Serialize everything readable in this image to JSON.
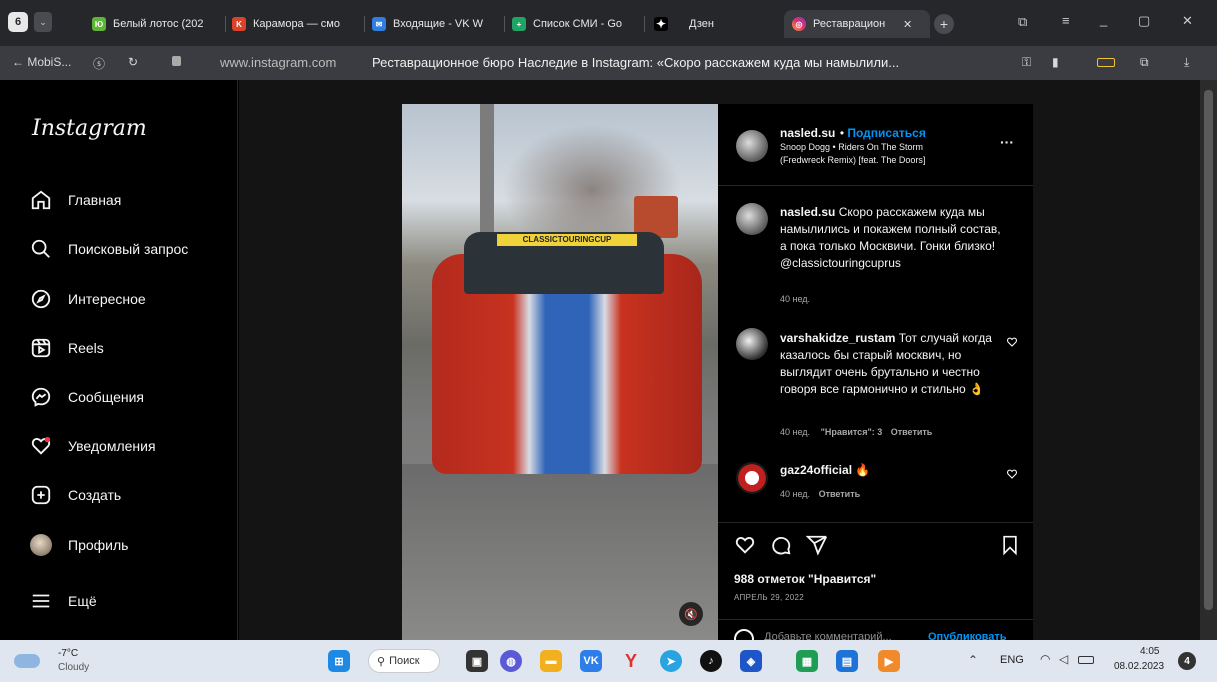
{
  "browser": {
    "tab_count": "6",
    "tabs": [
      {
        "label": "Белый лотос (202",
        "color": "#5fb336",
        "glyph": "Ю"
      },
      {
        "label": "Карамора — смо",
        "color": "#d8432a",
        "glyph": "K"
      },
      {
        "label": "Входящие - VK W",
        "color": "#2f7de1",
        "glyph": "✉"
      },
      {
        "label": "Список СМИ - Go",
        "color": "#1fa463",
        "glyph": "+"
      },
      {
        "label": "Дзен",
        "color": "#000000",
        "glyph": "✦"
      },
      {
        "label": "Реставрацион",
        "color": "#e1306c",
        "glyph": "◎"
      }
    ],
    "back_label": "← MobiS...",
    "url": "www.instagram.com",
    "page_title": "Реставрационное бюро Наследие в Instagram: «Скоро расскажем куда мы намылили..."
  },
  "sidebar": {
    "logo": "Instagram",
    "items": [
      {
        "label": "Главная",
        "icon": "home-icon"
      },
      {
        "label": "Поисковый запрос",
        "icon": "search-icon"
      },
      {
        "label": "Интересное",
        "icon": "explore-icon"
      },
      {
        "label": "Reels",
        "icon": "reels-icon"
      },
      {
        "label": "Сообщения",
        "icon": "messenger-icon"
      },
      {
        "label": "Уведомления",
        "icon": "heart-icon"
      },
      {
        "label": "Создать",
        "icon": "create-icon"
      },
      {
        "label": "Профиль",
        "icon": "profile-avatar"
      },
      {
        "label": "Ещё",
        "icon": "menu-icon"
      }
    ]
  },
  "post": {
    "photo_banner": "CLASSICTOURINGCUP",
    "author": "nasled.su",
    "follow": "Подписаться",
    "music_line1": "Snoop Dogg • Riders On The Storm",
    "music_line2": "(Fredwreck Remix) [feat. The Doors]",
    "caption_text": "Скоро расскажем куда мы намылились и покажем полный состав, а пока только Москвичи. Гонки близко! @classictouringcuprus",
    "caption_time": "40 нед.",
    "comments": [
      {
        "user": "varshakidze_rustam",
        "text": "Тот случай когда казалось бы старый москвич, но выглядит очень брутально и честно говоря все гармонично и стильно 👌",
        "time": "40 нед.",
        "likes": "\"Нравится\": 3",
        "reply": "Ответить"
      },
      {
        "user": "gaz24official",
        "text": "🔥",
        "time": "40 нед.",
        "reply": "Ответить"
      }
    ],
    "likes": "988 отметок \"Нравится\"",
    "date": "АПРЕЛЬ 29, 2022",
    "add_comment_placeholder": "Добавьте комментарий...",
    "publish": "Опубликовать"
  },
  "taskbar": {
    "weather_temp": "-7°C",
    "weather_desc": "Cloudy",
    "search": "Поиск",
    "lang": "ENG",
    "time": "4:05",
    "date": "08.02.2023",
    "notif_count": "4"
  }
}
